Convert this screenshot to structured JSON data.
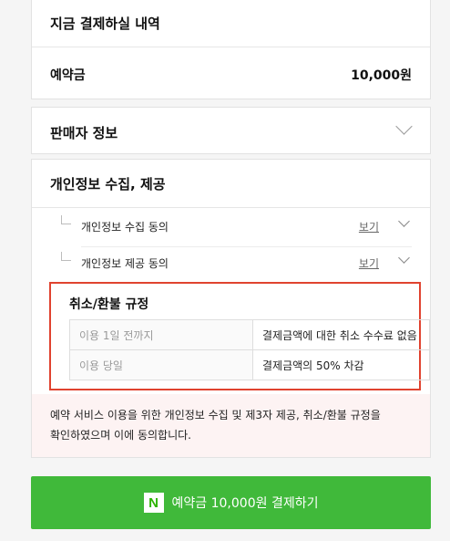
{
  "payment": {
    "title": "지금 결제하실 내역",
    "row_label": "예약금",
    "row_value": "10,000원"
  },
  "seller": {
    "title": "판매자 정보"
  },
  "privacy": {
    "title": "개인정보 수집, 제공",
    "items": [
      {
        "label": "개인정보 수집 동의",
        "view": "보기"
      },
      {
        "label": "개인정보 제공 동의",
        "view": "보기"
      }
    ]
  },
  "refund": {
    "title": "취소/환불 규정",
    "rows": [
      {
        "when": "이용 1일 전까지",
        "fee": "결제금액에 대한 취소 수수료 없음"
      },
      {
        "when": "이용 당일",
        "fee": "결제금액의 50% 차감"
      }
    ]
  },
  "notice": {
    "line1": "예약 서비스 이용을 위한 개인정보 수집 및 제3자 제공, 취소/환불 규정을",
    "line2": "확인하였으며 이에 동의합니다."
  },
  "pay_button": {
    "icon_letter": "N",
    "label": "예약금 10,000원 결제하기"
  },
  "colors": {
    "accent_green": "#40b93a",
    "highlight_red": "#e0432f",
    "notice_bg": "#fdf3f3"
  }
}
